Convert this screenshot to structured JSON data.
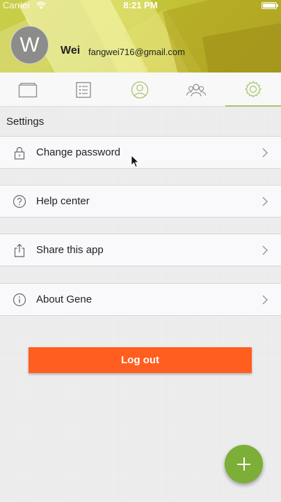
{
  "status_bar": {
    "carrier": "Carrier",
    "time": "8:21 PM"
  },
  "profile": {
    "avatar_letter": "W",
    "name": "Wei",
    "email": "fangwei716@gmail.com"
  },
  "tabs": [
    {
      "icon": "card-icon",
      "active": false
    },
    {
      "icon": "list-icon",
      "active": false
    },
    {
      "icon": "person-icon",
      "active": false
    },
    {
      "icon": "group-icon",
      "active": false
    },
    {
      "icon": "gear-icon",
      "active": true
    }
  ],
  "settings": {
    "title": "Settings",
    "items": [
      {
        "label": "Change password",
        "icon": "lock-icon"
      },
      {
        "label": "Help center",
        "icon": "help-icon"
      },
      {
        "label": "Share this app",
        "icon": "share-icon"
      },
      {
        "label": "About Gene",
        "icon": "info-icon"
      }
    ]
  },
  "logout_label": "Log out",
  "fab_icon": "plus-icon",
  "colors": {
    "accent": "#a5c46a",
    "logout": "#ff5e1f",
    "fab": "#7cae38"
  }
}
